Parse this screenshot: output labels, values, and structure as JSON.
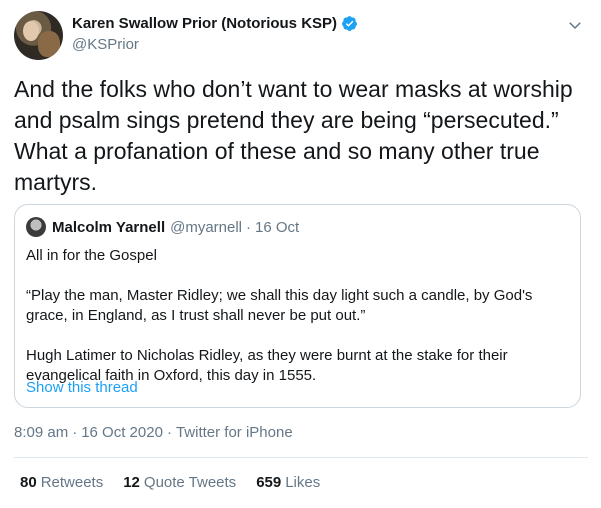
{
  "author": {
    "display_name": "Karen Swallow Prior (Notorious KSP)",
    "handle": "@KSPrior"
  },
  "tweet": {
    "text": "And the folks who don’t want to wear masks at worship and psalm sings pretend they are being “persecuted.” What a profanation of these and so many other true martyrs."
  },
  "quoted_tweet": {
    "display_name": "Malcolm Yarnell",
    "handle": "@myarnell",
    "separator": "·",
    "date": "16 Oct",
    "paragraphs": [
      "All in for the Gospel",
      "“Play the man, Master Ridley; we shall this day light such a candle, by God's grace, in England, as I trust shall never be put out.”",
      "Hugh Latimer to Nicholas Ridley, as they were burnt at the stake for their evangelical faith in Oxford, this day in 1555."
    ],
    "show_thread_label": "Show this thread"
  },
  "meta": {
    "time": "8:09 am",
    "separator": "·",
    "date": "16 Oct 2020",
    "source": "Twitter for iPhone"
  },
  "stats": {
    "retweets_count": "80",
    "retweets_label": "Retweets",
    "quotes_count": "12",
    "quotes_label": "Quote Tweets",
    "likes_count": "659",
    "likes_label": "Likes"
  },
  "colors": {
    "link": "#1da1f2",
    "secondary_text": "#657786",
    "border": "#ccd6dd"
  },
  "icons": {
    "verified": "verified-badge-icon",
    "menu": "chevron-down-icon"
  }
}
